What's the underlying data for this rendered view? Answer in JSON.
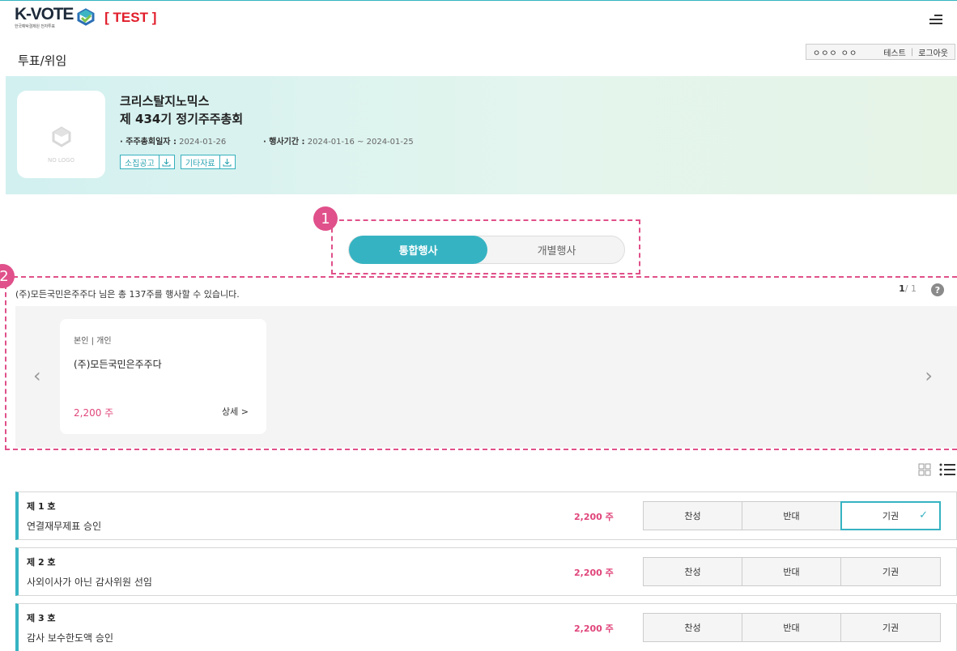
{
  "header": {
    "logo_text": "K-VOTE",
    "logo_sub": "한국예탁결제원 전자투표",
    "test_tag": "[ TEST ]",
    "page_title": "투표/위임",
    "user_name": "ㅇㅇㅇ ㅇㅇ",
    "user_suffix": "테스트",
    "logout_label": "로그아웃"
  },
  "banner": {
    "no_logo": "NO LOGO",
    "company": "크리스탈지노믹스",
    "meeting": "제 434기 정기주주총회",
    "meeting_date_label": "· 주주총회일자 :",
    "meeting_date": "2024-01-26",
    "period_label": "· 행사기간 :",
    "period": "2024-01-16 ~ 2024-01-25",
    "buttons": [
      "소집공고",
      "기타자료"
    ]
  },
  "annotations": {
    "marker1": "1",
    "marker2": "2"
  },
  "toggle": {
    "active": "통합행사",
    "inactive": "개별행사"
  },
  "notice": "(주)모든국민은주주다 님은 총 137주를 행사할 수 있습니다.",
  "pager": {
    "current": "1",
    "total": "/ 1"
  },
  "help": "?",
  "holder": {
    "type": "본인 | 개인",
    "name": "(주)모든국민은주주다",
    "shares": "2,200 주",
    "detail": "상세 >"
  },
  "arrows": {
    "prev": "‹",
    "next": "›"
  },
  "agenda": [
    {
      "no": "제 1 호",
      "title": "연결재무제표 승인",
      "shares": "2,200 주",
      "selected": "기권"
    },
    {
      "no": "제 2 호",
      "title": "사외이사가 아닌 감사위원 선임",
      "shares": "2,200 주",
      "selected": ""
    },
    {
      "no": "제 3 호",
      "title": "감사 보수한도액 승인",
      "shares": "2,200 주",
      "selected": ""
    }
  ],
  "vote_options": [
    "찬성",
    "반대",
    "기권"
  ],
  "colors": {
    "accent": "#36b3c2",
    "marker": "#e0508a",
    "shares": "#e0457b",
    "test": "#e11d2a"
  }
}
